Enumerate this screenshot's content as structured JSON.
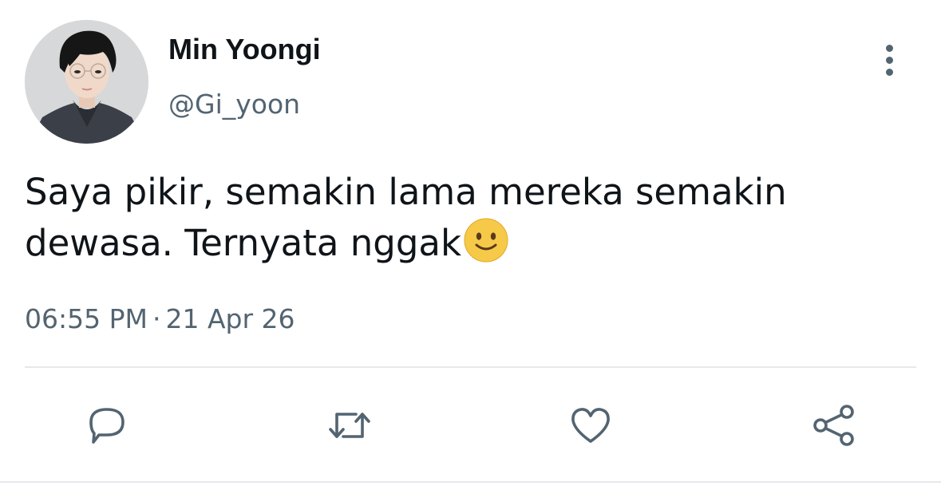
{
  "user": {
    "display_name": "Min Yoongi",
    "handle": "@Gi_yoon",
    "avatar_icon": "profile-photo"
  },
  "tweet": {
    "text": "Saya pikir, semakin lama mereka semakin dewasa. Ternyata nggak",
    "emoji": "slightly-smiling-face",
    "time": "06:55 PM",
    "separator": "·",
    "date": "21 Apr 26"
  },
  "actions": {
    "reply_icon": "comment-icon",
    "retweet_icon": "retweet-icon",
    "like_icon": "heart-icon",
    "share_icon": "share-icon",
    "more_icon": "more-vertical-icon"
  },
  "colors": {
    "text": "#0f1419",
    "secondary": "#536471",
    "divider": "#e6e9ec",
    "emoji": "#f7c948"
  }
}
